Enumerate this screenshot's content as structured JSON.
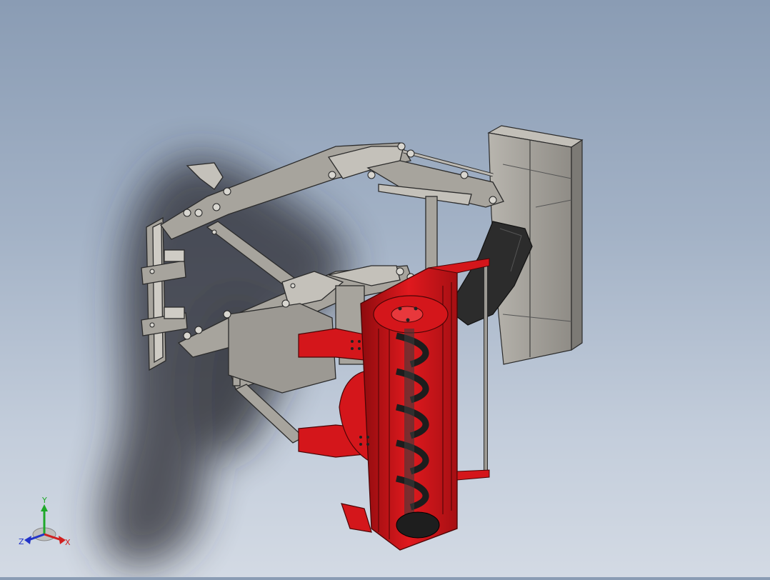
{
  "viewport": {
    "background_top": "#8a9cb4",
    "background_bottom": "#d3dae4",
    "model_colors": {
      "frame": "#a7a49d",
      "frame_edge": "#2b2b2b",
      "cutter": "#d4161b",
      "cutter_dark": "#8e0b0e",
      "box": "#9c9993",
      "belt": "#2c2c2c"
    }
  },
  "triad": {
    "x_label": "X",
    "y_label": "Y",
    "z_label": "Z",
    "x_color": "#d01f1f",
    "y_color": "#1fa82a",
    "z_color": "#2233c8"
  }
}
